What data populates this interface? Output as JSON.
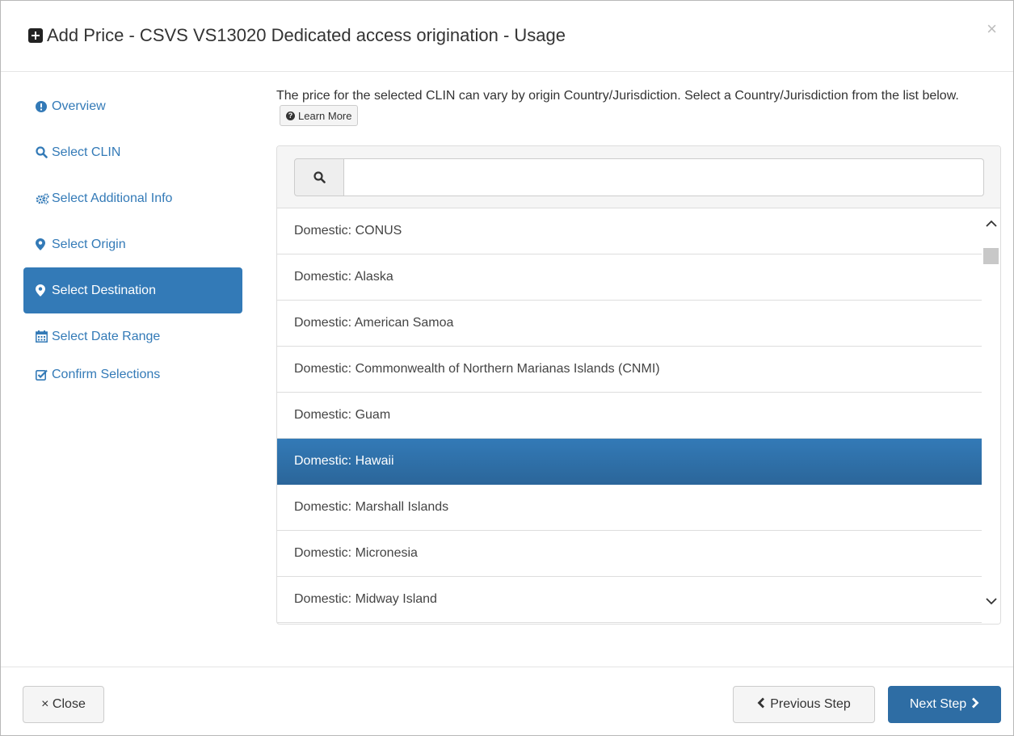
{
  "header": {
    "title": "Add Price - CSVS VS13020 Dedicated access origination - Usage",
    "icon": "plus-square-icon",
    "close_label": "×"
  },
  "sidebar": {
    "items": [
      {
        "label": "Overview",
        "icon": "info-circle-icon",
        "active": false
      },
      {
        "label": "Select CLIN",
        "icon": "search-icon",
        "active": false
      },
      {
        "label": "Select Additional Info",
        "icon": "gears-icon",
        "active": false
      },
      {
        "label": "Select Origin",
        "icon": "map-marker-icon",
        "active": false
      },
      {
        "label": "Select Destination",
        "icon": "map-marker-icon",
        "active": true
      },
      {
        "label": "Select Date Range",
        "icon": "calendar-icon",
        "active": false
      },
      {
        "label": "Confirm Selections",
        "icon": "check-square-icon",
        "active": false
      }
    ]
  },
  "main": {
    "description": "The price for the selected CLIN can vary by origin Country/Jurisdiction. Select a Country/Jurisdiction from the list below.",
    "learn_more_label": "Learn More",
    "search": {
      "value": "",
      "placeholder": ""
    },
    "list": [
      "Domestic: CONUS",
      "Domestic: Alaska",
      "Domestic: American Samoa",
      "Domestic: Commonwealth of Northern Marianas Islands (CNMI)",
      "Domestic: Guam",
      "Domestic: Hawaii",
      "Domestic: Marshall Islands",
      "Domestic: Micronesia",
      "Domestic: Midway Island"
    ],
    "selected_index": 5
  },
  "footer": {
    "close_label": "× Close",
    "prev_label": "Previous Step",
    "next_label": "Next Step"
  },
  "colors": {
    "primary": "#337ab7",
    "selected": "#2e6da4"
  }
}
